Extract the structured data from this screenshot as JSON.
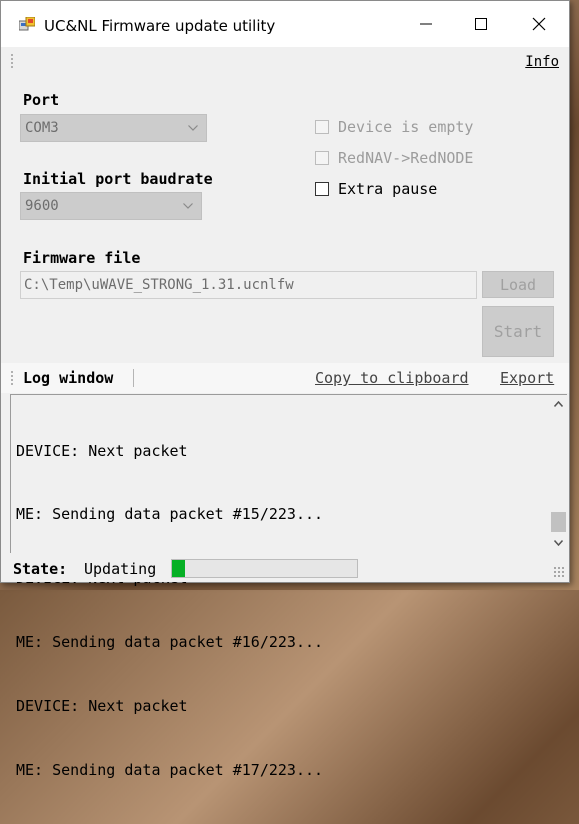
{
  "window": {
    "title": "UC&NL Firmware update utility"
  },
  "menu": {
    "info": "Info"
  },
  "port": {
    "label": "Port",
    "value": "COM3"
  },
  "baudrate": {
    "label": "Initial port baudrate",
    "value": "9600"
  },
  "options": {
    "device_empty": {
      "label": "Device is empty",
      "checked": false,
      "enabled": false
    },
    "rednav": {
      "label": "RedNAV->RedNODE",
      "checked": false,
      "enabled": false
    },
    "extra_pause": {
      "label": "Extra pause",
      "checked": false,
      "enabled": true
    }
  },
  "firmware": {
    "label": "Firmware file",
    "path": "C:\\Temp\\uWAVE_STRONG_1.31.ucnlfw",
    "load_label": "Load",
    "start_label": "Start"
  },
  "log": {
    "title": "Log window",
    "copy_label": "Copy to clipboard",
    "export_label": "Export",
    "lines": [
      "DEVICE: Next packet",
      "ME: Sending data packet #15/223...",
      "DEVICE: Next packet",
      "ME: Sending data packet #16/223...",
      "DEVICE: Next packet",
      "ME: Sending data packet #17/223..."
    ]
  },
  "status": {
    "label": "State:",
    "value": "Updating",
    "progress": 0.07
  },
  "colors": {
    "progress_fill": "#06b025",
    "disabled_fill": "#cccccc"
  }
}
